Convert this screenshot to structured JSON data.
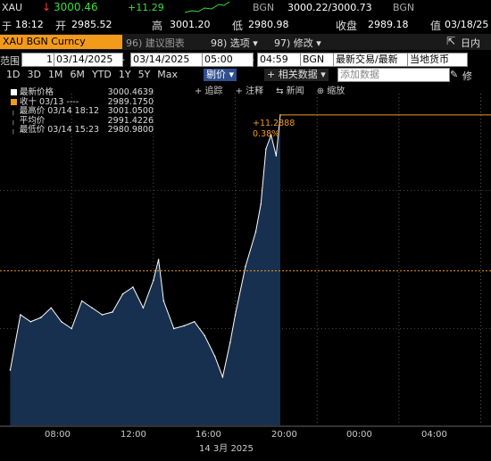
{
  "header": {
    "ticker": "XAU",
    "arrow": "↓",
    "last": "3000.46",
    "change": "+11.29",
    "source": "BGN",
    "bid_ask": "3000.22/3000.73",
    "source2": "BGN",
    "time_label": "于",
    "time": "18:12",
    "open_label": "开",
    "open": "2985.52",
    "high_label": "高",
    "high": "3001.20",
    "low_label": "低",
    "low": "2980.98",
    "close_label": "收盘",
    "close": "2989.18",
    "value_label": "值",
    "value_date": "03/18/25"
  },
  "toolbar": {
    "security": "XAU BGN Curncy",
    "menu_96": "96) 建议图表",
    "menu_98": "98) 选项 ▾",
    "menu_97": "97) 修改 ▾",
    "intraday": "日内"
  },
  "range": {
    "label": "范围",
    "days": "1",
    "start_date": "03/14/2025",
    "end_date": "03/14/2025",
    "start_time": "05:00",
    "end_time": "04:59",
    "source": "BGN",
    "pricing": "最新交易/最新",
    "currency": "当地货币"
  },
  "periods": {
    "items": [
      "1D",
      "3D",
      "1M",
      "6M",
      "YTD",
      "1Y",
      "5Y",
      "Max"
    ],
    "selected": "11",
    "chart_type": "剔价 ▾",
    "related": "+ 相关数据 ▾",
    "add_data": "添加数据",
    "modify": "修"
  },
  "chart_tools": {
    "items": [
      "+ 追踪",
      "+ 注释",
      "⇆ 新闻",
      "⊕ 缩放"
    ]
  },
  "legend": {
    "rows": [
      {
        "marker": "square-white",
        "name": "最新价格",
        "value": "3000.4639"
      },
      {
        "marker": "square-orange",
        "name": "收十 03/13 ----",
        "value": "2989.1750"
      },
      {
        "marker": "tick",
        "name": "最高价 03/14 18:12",
        "value": "3001.0500"
      },
      {
        "marker": "tick",
        "name": "平均价",
        "value": "2991.4226"
      },
      {
        "marker": "tick",
        "name": "最低价 03/14 15:23",
        "value": "2980.9800"
      }
    ]
  },
  "annotation": {
    "change": "+11.2888",
    "pct": "0.38%"
  },
  "xaxis": {
    "ticks": [
      "08:00",
      "12:00",
      "16:00",
      "20:00",
      "00:00",
      "04:00"
    ],
    "date_label": "14 3月 2025"
  },
  "colors": {
    "accent": "#f29a1a",
    "area_fill": "#18304f",
    "line": "#ffffff",
    "ref_line": "#f29a1a",
    "up": "#3adf3a",
    "down": "#ff3b3b"
  },
  "chart_data": {
    "type": "area",
    "x_unit": "time (hours, 03/14/2025)",
    "x": [
      "05:00",
      "05:30",
      "06:00",
      "06:30",
      "07:00",
      "07:30",
      "08:00",
      "08:30",
      "09:00",
      "09:30",
      "10:00",
      "10:30",
      "11:00",
      "11:30",
      "12:00",
      "12:15",
      "12:30",
      "13:00",
      "13:30",
      "14:00",
      "14:30",
      "15:00",
      "15:23",
      "15:45",
      "16:00",
      "16:30",
      "17:00",
      "17:15",
      "17:30",
      "17:45",
      "18:00",
      "18:12"
    ],
    "values": [
      2982.0,
      2986.0,
      2985.5,
      2985.8,
      2986.5,
      2985.5,
      2985.0,
      2987.0,
      2986.5,
      2986.0,
      2986.2,
      2987.5,
      2988.0,
      2986.5,
      2988.5,
      2990.0,
      2987.0,
      2985.0,
      2985.2,
      2985.5,
      2984.5,
      2983.0,
      2981.5,
      2984.0,
      2986.0,
      2989.5,
      2992.0,
      2994.0,
      2998.0,
      2999.0,
      2997.5,
      3000.46
    ],
    "previous_close": 2989.175,
    "ylim": [
      2978.0,
      3002.0
    ],
    "xlim": [
      4.5,
      28.5
    ],
    "grid": true,
    "legend": "top-left"
  }
}
